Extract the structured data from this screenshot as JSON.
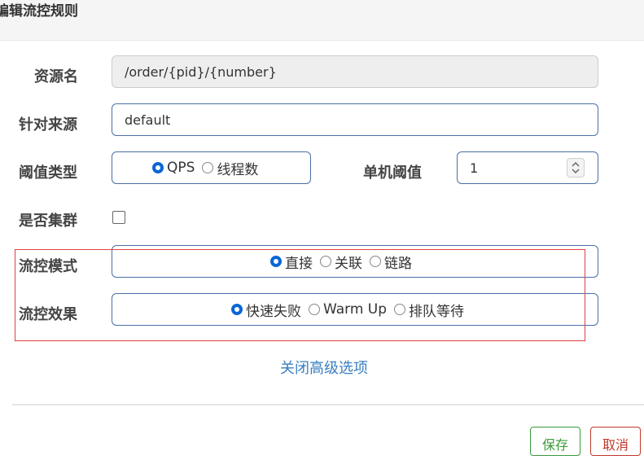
{
  "dialog": {
    "title": "编辑流控规则"
  },
  "form": {
    "resource": {
      "label": "资源名",
      "value": "/order/{pid}/{number}"
    },
    "origin": {
      "label": "针对来源",
      "value": "default"
    },
    "threshold_type": {
      "label": "阈值类型",
      "options": [
        "QPS",
        "线程数"
      ],
      "selected": "QPS"
    },
    "single_threshold": {
      "label": "单机阈值",
      "value": "1"
    },
    "cluster": {
      "label": "是否集群",
      "checked": false
    },
    "flow_mode": {
      "label": "流控模式",
      "options": [
        "直接",
        "关联",
        "链路"
      ],
      "selected": "直接"
    },
    "flow_effect": {
      "label": "流控效果",
      "options": [
        "快速失败",
        "Warm Up",
        "排队等待"
      ],
      "selected": "快速失败"
    },
    "advanced_toggle": "关闭高级选项"
  },
  "footer": {
    "save_label": "保存",
    "cancel_label": "取消"
  },
  "colors": {
    "accent": "#0a66d6",
    "highlight_border": "#e04040",
    "link": "#3a7fc1",
    "save": "#3c9a3c",
    "cancel": "#c0392b"
  }
}
